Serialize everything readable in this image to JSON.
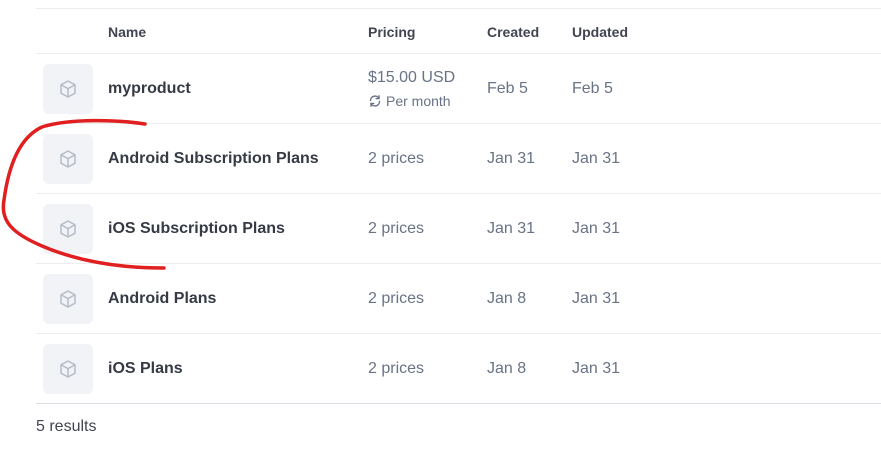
{
  "table": {
    "headers": {
      "name": "Name",
      "pricing": "Pricing",
      "created": "Created",
      "updated": "Updated"
    },
    "rows": [
      {
        "name": "myproduct",
        "price": "$15.00 USD",
        "price_interval": "Per month",
        "created": "Feb 5",
        "updated": "Feb 5",
        "icon": "product-box-icon"
      },
      {
        "name": "Android Subscription Plans",
        "price": "2 prices",
        "created": "Jan 31",
        "updated": "Jan 31",
        "icon": "product-box-icon"
      },
      {
        "name": "iOS Subscription Plans",
        "price": "2 prices",
        "created": "Jan 31",
        "updated": "Jan 31",
        "icon": "product-box-icon"
      },
      {
        "name": "Android Plans",
        "price": "2 prices",
        "created": "Jan 8",
        "updated": "Jan 31",
        "icon": "product-box-icon"
      },
      {
        "name": "iOS Plans",
        "price": "2 prices",
        "created": "Jan 8",
        "updated": "Jan 31",
        "icon": "product-box-icon"
      }
    ]
  },
  "footer": {
    "results": "5 results"
  },
  "colors": {
    "annotation_stroke": "#e02020",
    "thumb_bg": "#f1f3f6",
    "icon": "#b6bcc7"
  }
}
